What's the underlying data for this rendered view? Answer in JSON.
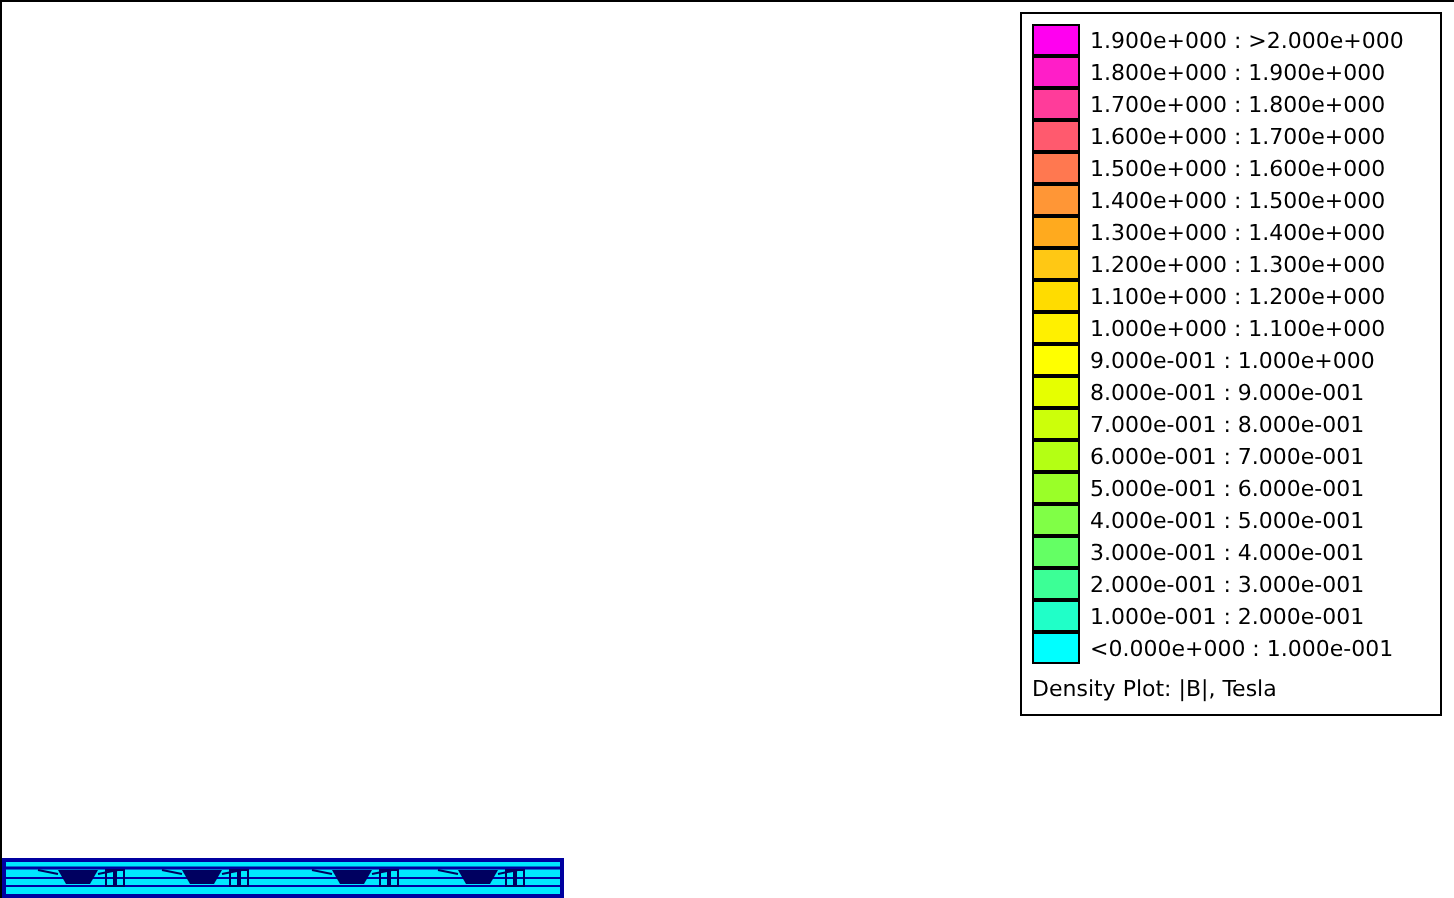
{
  "legend": {
    "entries": [
      {
        "label": "1.900e+000 : >2.000e+000",
        "color": "#ff00f0"
      },
      {
        "label": "1.800e+000 : 1.900e+000",
        "color": "#ff1ec8"
      },
      {
        "label": "1.700e+000 : 1.800e+000",
        "color": "#ff3c9a"
      },
      {
        "label": "1.600e+000 : 1.700e+000",
        "color": "#ff5a6e"
      },
      {
        "label": "1.500e+000 : 1.600e+000",
        "color": "#ff7850"
      },
      {
        "label": "1.400e+000 : 1.500e+000",
        "color": "#ff9636"
      },
      {
        "label": "1.300e+000 : 1.400e+000",
        "color": "#ffaa1e"
      },
      {
        "label": "1.200e+000 : 1.300e+000",
        "color": "#ffc814"
      },
      {
        "label": "1.100e+000 : 1.200e+000",
        "color": "#ffdc00"
      },
      {
        "label": "1.000e+000 : 1.100e+000",
        "color": "#fff000"
      },
      {
        "label": "9.000e-001 : 1.000e+000",
        "color": "#ffff00"
      },
      {
        "label": "8.000e-001 : 9.000e-001",
        "color": "#e6ff00"
      },
      {
        "label": "7.000e-001 : 8.000e-001",
        "color": "#ccff0a"
      },
      {
        "label": "6.000e-001 : 7.000e-001",
        "color": "#b4ff14"
      },
      {
        "label": "5.000e-001 : 6.000e-001",
        "color": "#9aff28"
      },
      {
        "label": "4.000e-001 : 5.000e-001",
        "color": "#80ff46"
      },
      {
        "label": "3.000e-001 : 4.000e-001",
        "color": "#64ff64"
      },
      {
        "label": "2.000e-001 : 3.000e-001",
        "color": "#3cff96"
      },
      {
        "label": "1.000e-001 : 2.000e-001",
        "color": "#20ffc8"
      },
      {
        "label": "<0.000e+000 : 1.000e-001",
        "color": "#00ffff"
      }
    ],
    "caption": "Density Plot: |B|, Tesla"
  }
}
